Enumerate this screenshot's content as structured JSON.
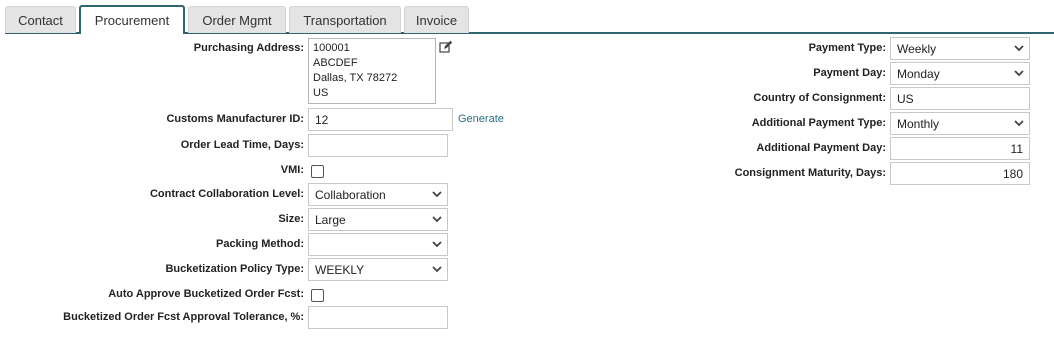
{
  "tabs": [
    {
      "label": "Contact",
      "active": false
    },
    {
      "label": "Procurement",
      "active": true
    },
    {
      "label": "Order Mgmt",
      "active": false
    },
    {
      "label": "Transportation",
      "active": false
    },
    {
      "label": "Invoice",
      "active": false
    }
  ],
  "left": {
    "purchasing_address": {
      "label": "Purchasing Address:",
      "lines": [
        "100001",
        "ABCDEF",
        "Dallas, TX 78272",
        "US"
      ],
      "edit_icon": "edit-icon"
    },
    "customs_manufacturer_id": {
      "label": "Customs Manufacturer ID:",
      "value": "12",
      "action": "Generate"
    },
    "order_lead_time": {
      "label": "Order Lead Time, Days:",
      "value": ""
    },
    "vmi": {
      "label": "VMI:",
      "checked": false
    },
    "contract_collaboration_level": {
      "label": "Contract Collaboration Level:",
      "value": "Collaboration"
    },
    "size": {
      "label": "Size:",
      "value": "Large"
    },
    "packing_method": {
      "label": "Packing Method:",
      "value": ""
    },
    "bucketization_policy_type": {
      "label": "Bucketization Policy Type:",
      "value": "WEEKLY"
    },
    "auto_approve": {
      "label": "Auto Approve Bucketized Order Fcst:",
      "checked": false
    },
    "approval_tolerance": {
      "label": "Bucketized Order Fcst Approval Tolerance, %:",
      "value": ""
    }
  },
  "right": {
    "payment_type": {
      "label": "Payment Type:",
      "value": "Weekly"
    },
    "payment_day": {
      "label": "Payment Day:",
      "value": "Monday"
    },
    "country_of_consignment": {
      "label": "Country of Consignment:",
      "value": "US"
    },
    "additional_payment_type": {
      "label": "Additional Payment Type:",
      "value": "Monthly"
    },
    "additional_payment_day": {
      "label": "Additional Payment Day:",
      "value": "11"
    },
    "consignment_maturity": {
      "label": "Consignment Maturity, Days:",
      "value": "180"
    }
  },
  "colors": {
    "accent": "#2f6470",
    "link": "#2a6e86",
    "tab_bg": "#e4e4e4"
  }
}
